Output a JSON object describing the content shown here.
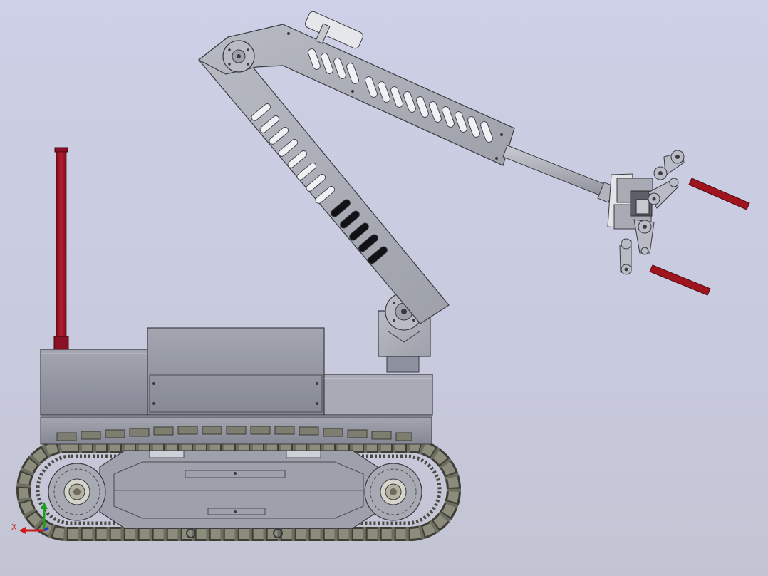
{
  "view": {
    "background_colors": [
      "#cdd0e6",
      "#c3c4d3"
    ]
  },
  "model": {
    "body_color": "#8e929e",
    "body_light_color": "#a9acb6",
    "metal_color": "#b3b5bc",
    "edge_color": "#3a3b42",
    "track_color": "#77776a",
    "antenna_color": "#a2152a",
    "gripper_finger_color": "#a0141e",
    "components": [
      "tracked-chassis",
      "drive-track",
      "drive-sprocket",
      "idler-wheel",
      "antenna",
      "control-box",
      "battery-box",
      "arm-base",
      "lower-arm",
      "upper-arm",
      "arm-actuator",
      "telescopic-rod",
      "gripper",
      "gripper-fingers"
    ]
  },
  "axis_triad": {
    "x_label": "X",
    "x_color": "#d01919",
    "y_color": "#1aa01a",
    "z_color": "#1f3ad0"
  }
}
